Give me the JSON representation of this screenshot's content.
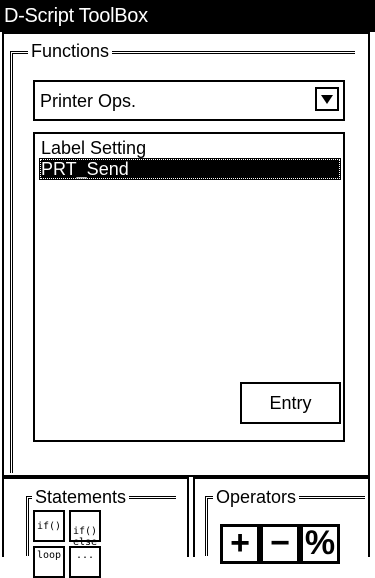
{
  "window": {
    "title": "D-Script ToolBox"
  },
  "functions": {
    "group_label": "Functions",
    "category": "Printer Ops.",
    "items": [
      {
        "label": "Label Setting",
        "selected": false
      },
      {
        "label": "PRT_Send",
        "selected": true
      }
    ],
    "entry_label": "Entry"
  },
  "statements": {
    "group_label": "Statements",
    "buttons": [
      "if()",
      "if()\nelse",
      "loop",
      "..."
    ]
  },
  "operators": {
    "group_label": "Operators",
    "buttons": [
      "+",
      "−",
      "%"
    ]
  }
}
